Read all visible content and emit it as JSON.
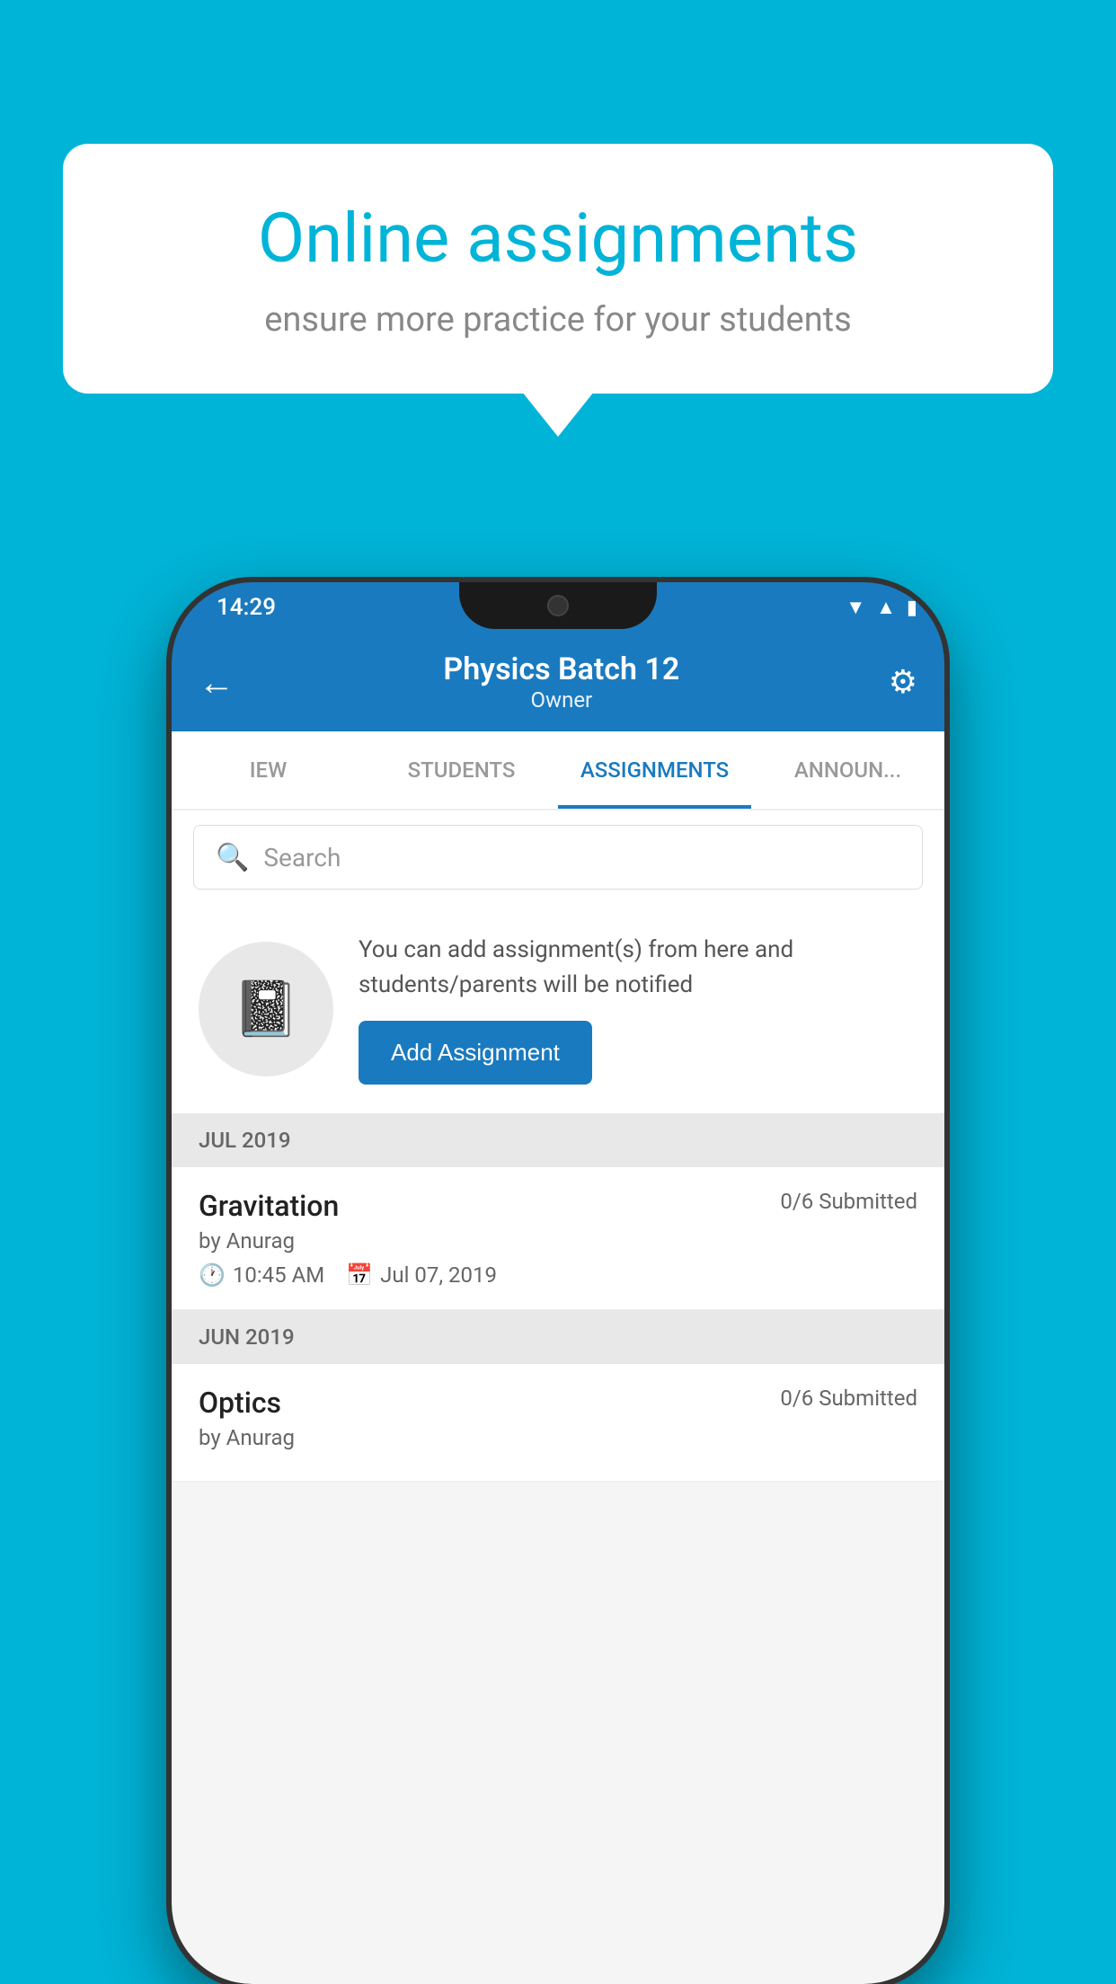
{
  "background": {
    "color": "#00b4d8"
  },
  "speech_bubble": {
    "title": "Online assignments",
    "subtitle": "ensure more practice for your students"
  },
  "status_bar": {
    "time": "14:29",
    "wifi_icon": "▼",
    "signal_icon": "▲",
    "battery_icon": "▮"
  },
  "header": {
    "title": "Physics Batch 12",
    "subtitle": "Owner",
    "back_label": "←",
    "settings_label": "⚙"
  },
  "tabs": [
    {
      "label": "IEW",
      "active": false
    },
    {
      "label": "STUDENTS",
      "active": false
    },
    {
      "label": "ASSIGNMENTS",
      "active": true
    },
    {
      "label": "ANNOUNCEMENTS",
      "active": false
    }
  ],
  "search": {
    "placeholder": "Search"
  },
  "promo_card": {
    "description": "You can add assignment(s) from here and students/parents will be notified",
    "button_label": "Add Assignment"
  },
  "sections": [
    {
      "label": "JUL 2019",
      "assignments": [
        {
          "name": "Gravitation",
          "submitted": "0/6 Submitted",
          "author": "by Anurag",
          "time": "10:45 AM",
          "date": "Jul 07, 2019"
        }
      ]
    },
    {
      "label": "JUN 2019",
      "assignments": [
        {
          "name": "Optics",
          "submitted": "0/6 Submitted",
          "author": "by Anurag",
          "time": "",
          "date": ""
        }
      ]
    }
  ]
}
